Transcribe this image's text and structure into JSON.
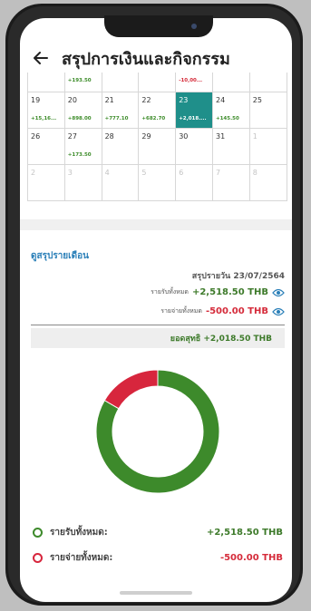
{
  "header": {
    "title": "สรุปการเงินและกิจกรรม",
    "back_icon": "arrow-left-icon"
  },
  "calendar": {
    "partial_row": [
      {
        "day": "",
        "amount": ""
      },
      {
        "day": "",
        "amount": "+193.50",
        "type": "pos"
      },
      {
        "day": "",
        "amount": ""
      },
      {
        "day": "",
        "amount": ""
      },
      {
        "day": "",
        "amount": "-10,00...",
        "type": "neg"
      },
      {
        "day": "",
        "amount": ""
      },
      {
        "day": "",
        "amount": ""
      }
    ],
    "weeks": [
      [
        {
          "day": "19",
          "amount": "+15,16...",
          "type": "pos"
        },
        {
          "day": "20",
          "amount": "+898.00",
          "type": "pos"
        },
        {
          "day": "21",
          "amount": "+777.10",
          "type": "pos"
        },
        {
          "day": "22",
          "amount": "+682.70",
          "type": "pos"
        },
        {
          "day": "23",
          "amount": "+2,018....",
          "type": "pos",
          "selected": true
        },
        {
          "day": "24",
          "amount": "+145.50",
          "type": "pos"
        },
        {
          "day": "25",
          "amount": ""
        }
      ],
      [
        {
          "day": "26",
          "amount": ""
        },
        {
          "day": "27",
          "amount": "+173.50",
          "type": "pos"
        },
        {
          "day": "28",
          "amount": ""
        },
        {
          "day": "29",
          "amount": ""
        },
        {
          "day": "30",
          "amount": ""
        },
        {
          "day": "31",
          "amount": ""
        },
        {
          "day": "1",
          "amount": "",
          "dim": true
        }
      ],
      [
        {
          "day": "2",
          "amount": "",
          "dim": true
        },
        {
          "day": "3",
          "amount": "",
          "dim": true
        },
        {
          "day": "4",
          "amount": "",
          "dim": true
        },
        {
          "day": "5",
          "amount": "",
          "dim": true
        },
        {
          "day": "6",
          "amount": "",
          "dim": true
        },
        {
          "day": "7",
          "amount": "",
          "dim": true
        },
        {
          "day": "8",
          "amount": "",
          "dim": true
        }
      ]
    ]
  },
  "summary": {
    "month_link": "ดูสรุปรายเดือน",
    "date_text": "สรุปรายวัน 23/07/2564",
    "income_label": "รายรับทั้งหมด",
    "income_value": "+2,518.50 THB",
    "expense_label": "รายจ่ายทั้งหมด",
    "expense_value": "-500.00 THB",
    "net_text": "ยอดสุทธิ +2,018.50 THB"
  },
  "chart_data": {
    "type": "pie",
    "categories": [
      "รายรับทั้งหมด",
      "รายจ่ายทั้งหมด"
    ],
    "values": [
      2518.5,
      500.0
    ],
    "colors": [
      "#3d8a2b",
      "#d7263d"
    ]
  },
  "legend": {
    "income_label": "รายรับทั้งหมด:",
    "income_value": "+2,518.50 THB",
    "expense_label": "รายจ่ายทั้งหมด:",
    "expense_value": "-500.00 THB"
  },
  "colors": {
    "income": "#3d8a2b",
    "expense": "#d7263d",
    "selected_day": "#1f8f8a",
    "link": "#2a7fb8"
  }
}
